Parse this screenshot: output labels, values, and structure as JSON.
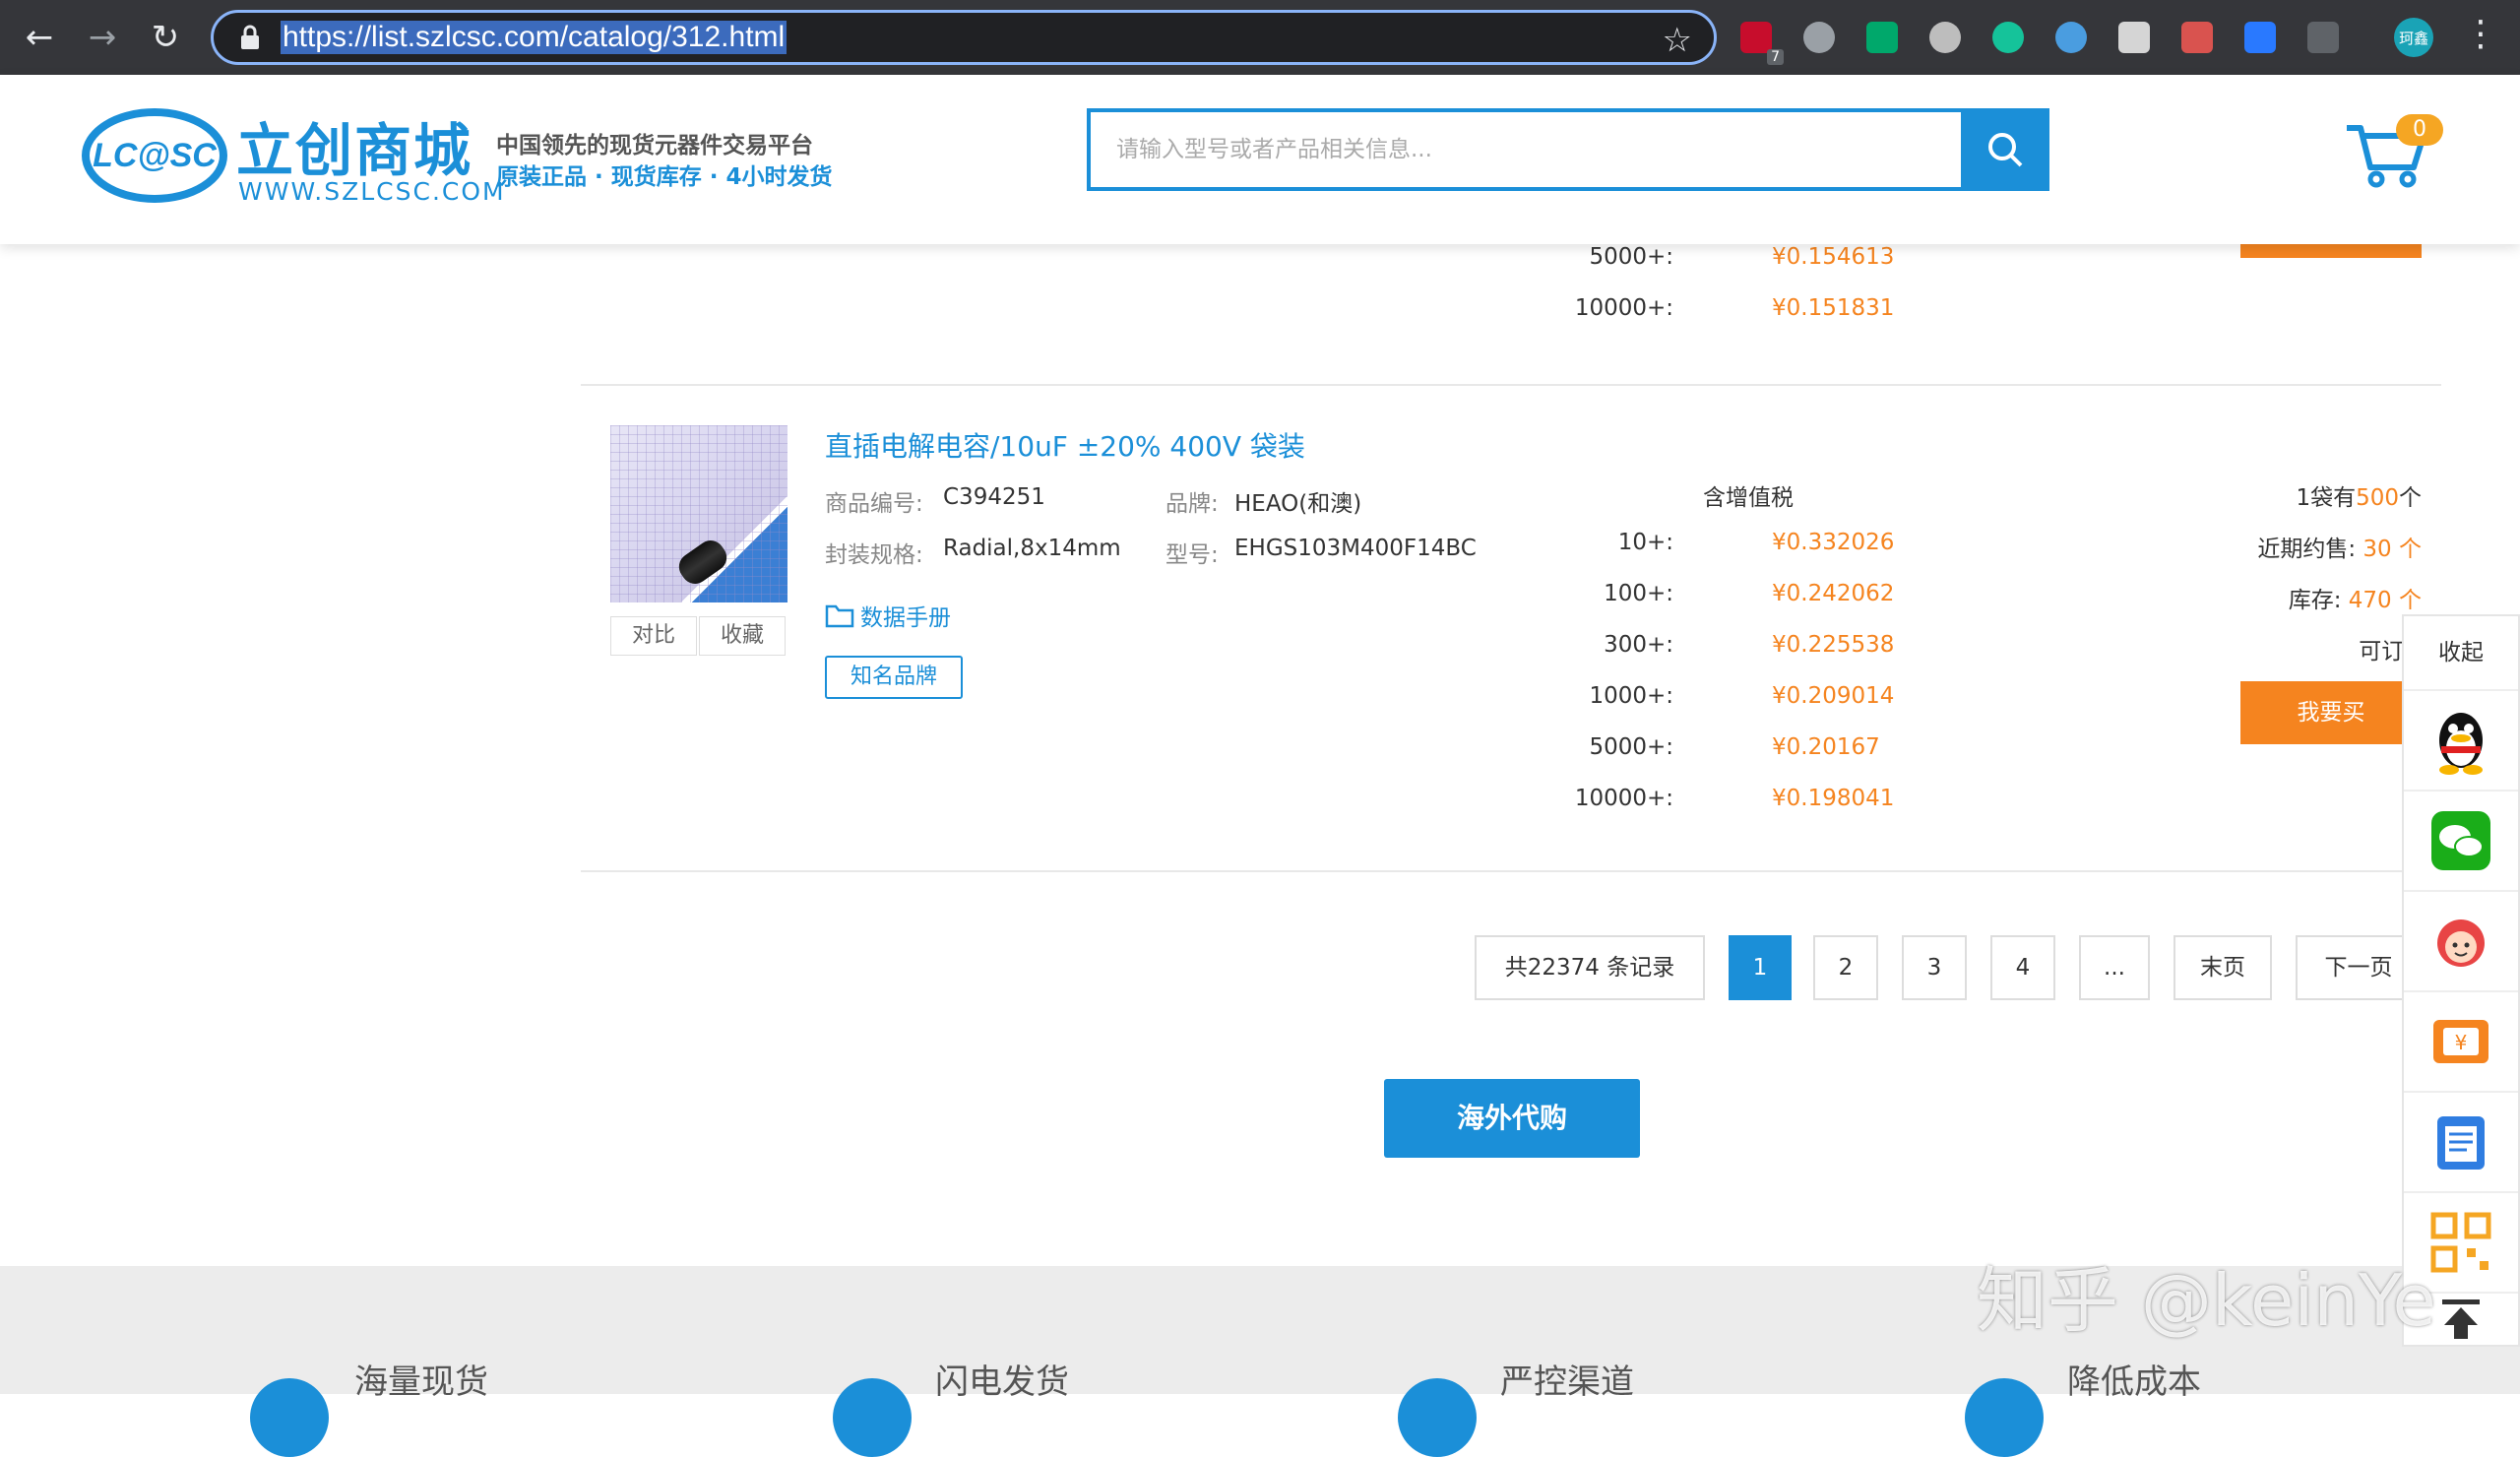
{
  "browser": {
    "url": "https://list.szlcsc.com/catalog/312.html",
    "extensions": [
      "abp-icon",
      "circle-icon",
      "tampermonkey-icon",
      "s-icon",
      "grammarly-icon",
      "feather-icon",
      "printer-icon",
      "a-icon",
      "pocket-icon",
      "shield-icon"
    ],
    "abp_badge": "7",
    "profile_label": "珂鑫"
  },
  "header": {
    "logo_text": "LC@SC",
    "brand": "立创商城",
    "site": "WWW.SZLCSC.COM",
    "slogan_line1": "中国领先的现货元器件交易平台",
    "slogan_line2": "原装正品 · 现货库存 · 4小时发货",
    "search_placeholder": "请输入型号或者产品相关信息...",
    "cart_count": "0"
  },
  "previous_item": {
    "tiers": [
      {
        "qty": "5000+:",
        "price": "¥0.154613"
      },
      {
        "qty": "10000+:",
        "price": "¥0.151831"
      }
    ]
  },
  "product": {
    "title": "直插电解电容/10uF ±20% 400V 袋装",
    "compare_label": "对比",
    "favorite_label": "收藏",
    "sku_label": "商品编号:",
    "sku": "C394251",
    "brand_label": "品牌:",
    "brand": "HEAO(和澳)",
    "package_label": "封装规格:",
    "package": "Radial,8x14mm",
    "model_label": "型号:",
    "model": "EHGS103M400F14BC",
    "datasheet": "数据手册",
    "badge": "知名品牌",
    "tax_note": "含增值税",
    "tiers": [
      {
        "qty": "10+:",
        "price": "¥0.332026"
      },
      {
        "qty": "100+:",
        "price": "¥0.242062"
      },
      {
        "qty": "300+:",
        "price": "¥0.225538"
      },
      {
        "qty": "1000+:",
        "price": "¥0.209014"
      },
      {
        "qty": "5000+:",
        "price": "¥0.20167"
      },
      {
        "qty": "10000+:",
        "price": "¥0.198041"
      }
    ],
    "pack_prefix": "1袋有",
    "pack_count": "500",
    "pack_suffix": "个",
    "recent_label": "近期约售:",
    "recent_value": "30 个",
    "stock_label": "库存:",
    "stock_value": "470 个",
    "orderable": "可订:",
    "buy_label": "我要买"
  },
  "pagination": {
    "total": "共22374 条记录",
    "pages": [
      "1",
      "2",
      "3",
      "4",
      "..."
    ],
    "last": "末页",
    "next": "下一页"
  },
  "overseas_label": "海外代购",
  "footer_features": [
    "海量现货",
    "闪电发货",
    "严控渠道",
    "降低成本"
  ],
  "sidebar": {
    "collapse": "收起",
    "items": [
      "qq-icon",
      "wechat-icon",
      "service-icon",
      "coupon-icon",
      "notes-icon",
      "qrcode-icon",
      "back-to-top-icon"
    ]
  },
  "watermark": "知乎 @keinYe",
  "colors": {
    "primary": "#1b8fd8",
    "accent": "#f5841f"
  }
}
